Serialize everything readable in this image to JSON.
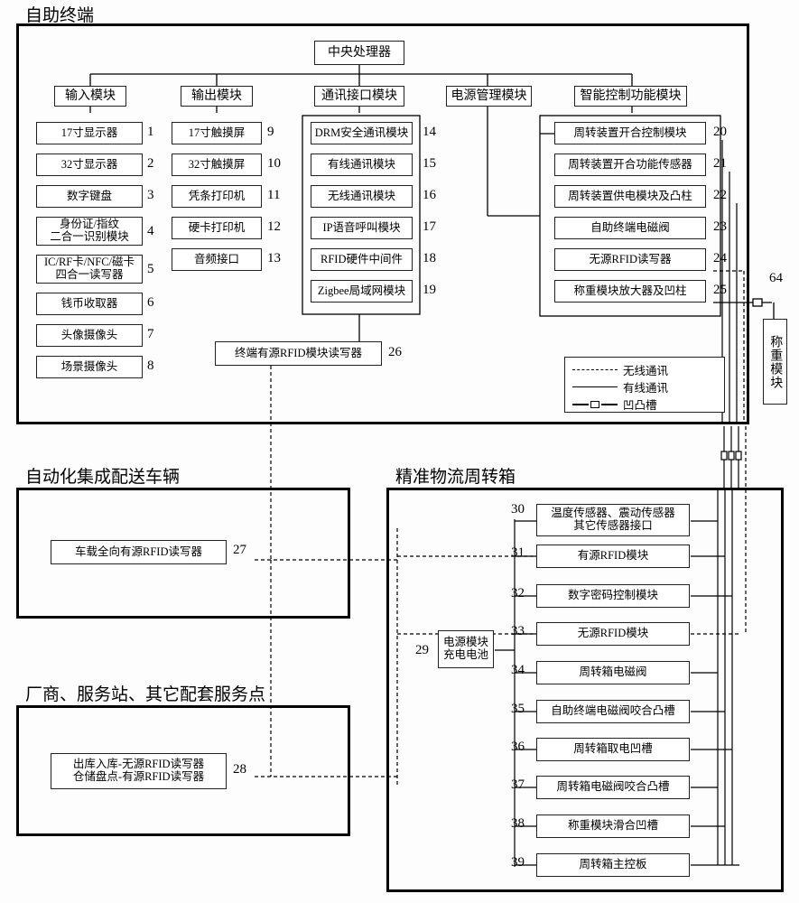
{
  "sections": {
    "terminal": "自助终端",
    "vehicle": "自动化集成配送车辆",
    "vendor": "厂商、服务站、其它配套服务点",
    "crate": "精准物流周转箱"
  },
  "cpu": "中央处理器",
  "col_headers": {
    "input": "输入模块",
    "output": "输出模块",
    "comm": "通讯接口模块",
    "power": "电源管理模块",
    "smart": "智能控制功能模块"
  },
  "inputs": {
    "i1": "17寸显示器",
    "n1": "1",
    "i2": "32寸显示器",
    "n2": "2",
    "i3": "数字键盘",
    "n3": "3",
    "i4": "身份证/指纹\n二合一识别模块",
    "n4": "4",
    "i5": "IC/RF卡/NFC/磁卡\n四合一读写器",
    "n5": "5",
    "i6": "钱币收取器",
    "n6": "6",
    "i7": "头像摄像头",
    "n7": "7",
    "i8": "场景摄像头",
    "n8": "8"
  },
  "outputs": {
    "o9": "17寸触摸屏",
    "n9": "9",
    "o10": "32寸触摸屏",
    "n10": "10",
    "o11": "凭条打印机",
    "n11": "11",
    "o12": "硬卡打印机",
    "n12": "12",
    "o13": "音频接口",
    "n13": "13"
  },
  "comm": {
    "c14": "DRM安全通讯模块",
    "n14": "14",
    "c15": "有线通讯模块",
    "n15": "15",
    "c16": "无线通讯模块",
    "n16": "16",
    "c17": "IP语音呼叫模块",
    "n17": "17",
    "c18": "RFID硬件中间件",
    "n18": "18",
    "c19": "Zigbee局域网模块",
    "n19": "19"
  },
  "smart": {
    "s20": "周转装置开合控制模块",
    "n20": "20",
    "s21": "周转装置开合功能传感器",
    "n21": "21",
    "s22": "周转装置供电模块及凸柱",
    "n22": "22",
    "s23": "自助终端电磁阀",
    "n23": "23",
    "s24": "无源RFID读写器",
    "n24": "24",
    "s25": "称重模块放大器及凹柱",
    "n25": "25"
  },
  "extra": {
    "e26": "终端有源RFID模块读写器",
    "n26": "26",
    "e27": "车载全向有源RFID读写器",
    "n27": "27",
    "e28": "出库入库-无源RFID读写器\n仓储盘点-有源RFID读写器",
    "n28": "28"
  },
  "crate": {
    "b29": "电源模块\n充电电池",
    "n29": "29",
    "b30": "温度传感器、震动传感器\n其它传感器接口",
    "n30": "30",
    "b31": "有源RFID模块",
    "n31": "31",
    "b32": "数字密码控制模块",
    "n32": "32",
    "b33": "无源RFID模块",
    "n33": "33",
    "b34": "周转箱电磁阀",
    "n34": "34",
    "b35": "自助终端电磁阀咬合凸槽",
    "n35": "35",
    "b36": "周转箱取电凹槽",
    "n36": "36",
    "b37": "周转箱电磁阀咬合凸槽",
    "n37": "37",
    "b38": "称重模块滑合凹槽",
    "n38": "38",
    "b39": "周转箱主控板",
    "n39": "39"
  },
  "right": {
    "n64": "64",
    "weigh": "称重模块"
  },
  "legend": {
    "wireless": "无线通讯",
    "wired": "有线通讯",
    "slot": "凹凸槽"
  }
}
